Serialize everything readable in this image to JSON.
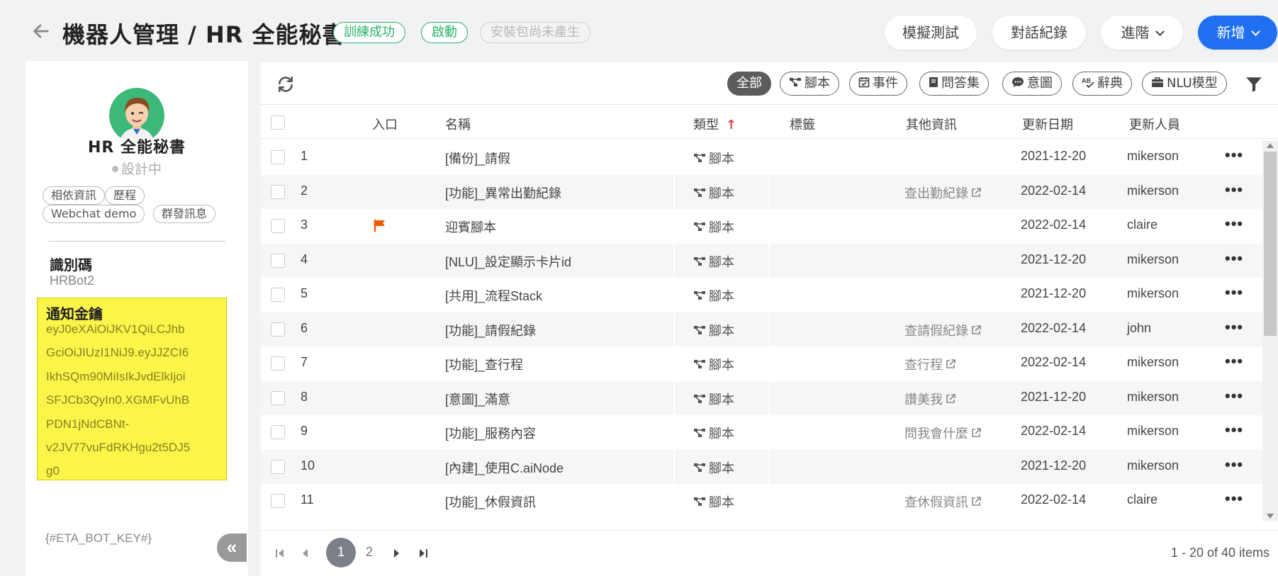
{
  "header": {
    "title": "機器人管理 / HR 全能秘書",
    "badges": [
      "訓練成功",
      "啟動",
      "安裝包尚未產生"
    ],
    "buttons": {
      "simulate": "模擬測試",
      "history": "對話紀錄",
      "advanced": "進階",
      "add": "新增"
    }
  },
  "sidebar": {
    "bot_name": "HR 全能秘書",
    "status": "設計中",
    "tags": [
      "相依資訊",
      "歷程",
      "Webchat demo",
      "群發訊息"
    ],
    "id_label": "識別碼",
    "id_value": "HRBot2",
    "key_label": "通知金鑰",
    "key_lines": [
      "eyJ0eXAiOiJKV1QiLCJhb",
      "GciOiJIUzI1NiJ9.eyJJZCI6",
      "IkhSQm90MiIsIkJvdElkIjoi",
      "SFJCb3QyIn0.XGMFvUhB",
      "PDN1jNdCBNt-",
      "v2JV77vuFdRKHgu2t5DJ5",
      "g0"
    ],
    "key_template": "{#ETA_BOT_KEY#}"
  },
  "filters": [
    {
      "label": "全部",
      "icon": "",
      "active": true
    },
    {
      "label": "腳本",
      "icon": "flow-icon",
      "active": false
    },
    {
      "label": "事件",
      "icon": "calendar-check-icon",
      "active": false
    },
    {
      "label": "問答集",
      "icon": "book-icon",
      "active": false
    },
    {
      "label": "意圖",
      "icon": "chat-bubble-icon",
      "active": false
    },
    {
      "label": "辭典",
      "icon": "spellcheck-icon",
      "active": false
    },
    {
      "label": "NLU模型",
      "icon": "box-icon",
      "active": false
    }
  ],
  "table": {
    "columns": {
      "entry": "入口",
      "name": "名稱",
      "type": "類型",
      "tags": "標籤",
      "other": "其他資訊",
      "date": "更新日期",
      "user": "更新人員"
    },
    "rows": [
      {
        "no": "1",
        "name": "[備份]_請假",
        "type": "腳本",
        "other": "",
        "date": "2021-12-20",
        "user": "mikerson",
        "entry": false
      },
      {
        "no": "2",
        "name": "[功能]_異常出勤紀錄",
        "type": "腳本",
        "other": "查出勤紀錄",
        "date": "2022-02-14",
        "user": "mikerson",
        "entry": false
      },
      {
        "no": "3",
        "name": "迎賓腳本",
        "type": "腳本",
        "other": "",
        "date": "2022-02-14",
        "user": "claire",
        "entry": true
      },
      {
        "no": "4",
        "name": "[NLU]_設定顯示卡片id",
        "type": "腳本",
        "other": "",
        "date": "2021-12-20",
        "user": "mikerson",
        "entry": false
      },
      {
        "no": "5",
        "name": "[共用]_流程Stack",
        "type": "腳本",
        "other": "",
        "date": "2021-12-20",
        "user": "mikerson",
        "entry": false
      },
      {
        "no": "6",
        "name": "[功能]_請假紀錄",
        "type": "腳本",
        "other": "查請假紀錄",
        "date": "2022-02-14",
        "user": "john",
        "entry": false
      },
      {
        "no": "7",
        "name": "[功能]_查行程",
        "type": "腳本",
        "other": "查行程",
        "date": "2022-02-14",
        "user": "mikerson",
        "entry": false
      },
      {
        "no": "8",
        "name": "[意圖]_滿意",
        "type": "腳本",
        "other": "讚美我",
        "date": "2021-12-20",
        "user": "mikerson",
        "entry": false
      },
      {
        "no": "9",
        "name": "[功能]_服務內容",
        "type": "腳本",
        "other": "問我會什麼",
        "date": "2022-02-14",
        "user": "mikerson",
        "entry": false
      },
      {
        "no": "10",
        "name": "[內建]_使用C.aiNode",
        "type": "腳本",
        "other": "",
        "date": "2021-12-20",
        "user": "mikerson",
        "entry": false
      },
      {
        "no": "11",
        "name": "[功能]_休假資訊",
        "type": "腳本",
        "other": "查休假資訊",
        "date": "2022-02-14",
        "user": "claire",
        "entry": false
      }
    ]
  },
  "pager": {
    "current": "1",
    "next_page": "2",
    "summary": "1 - 20 of 40 items"
  },
  "colors": {
    "primary": "#1f6ff0",
    "success": "#27b36a",
    "highlight": "#fbf54a",
    "flag": "#f05a00"
  }
}
